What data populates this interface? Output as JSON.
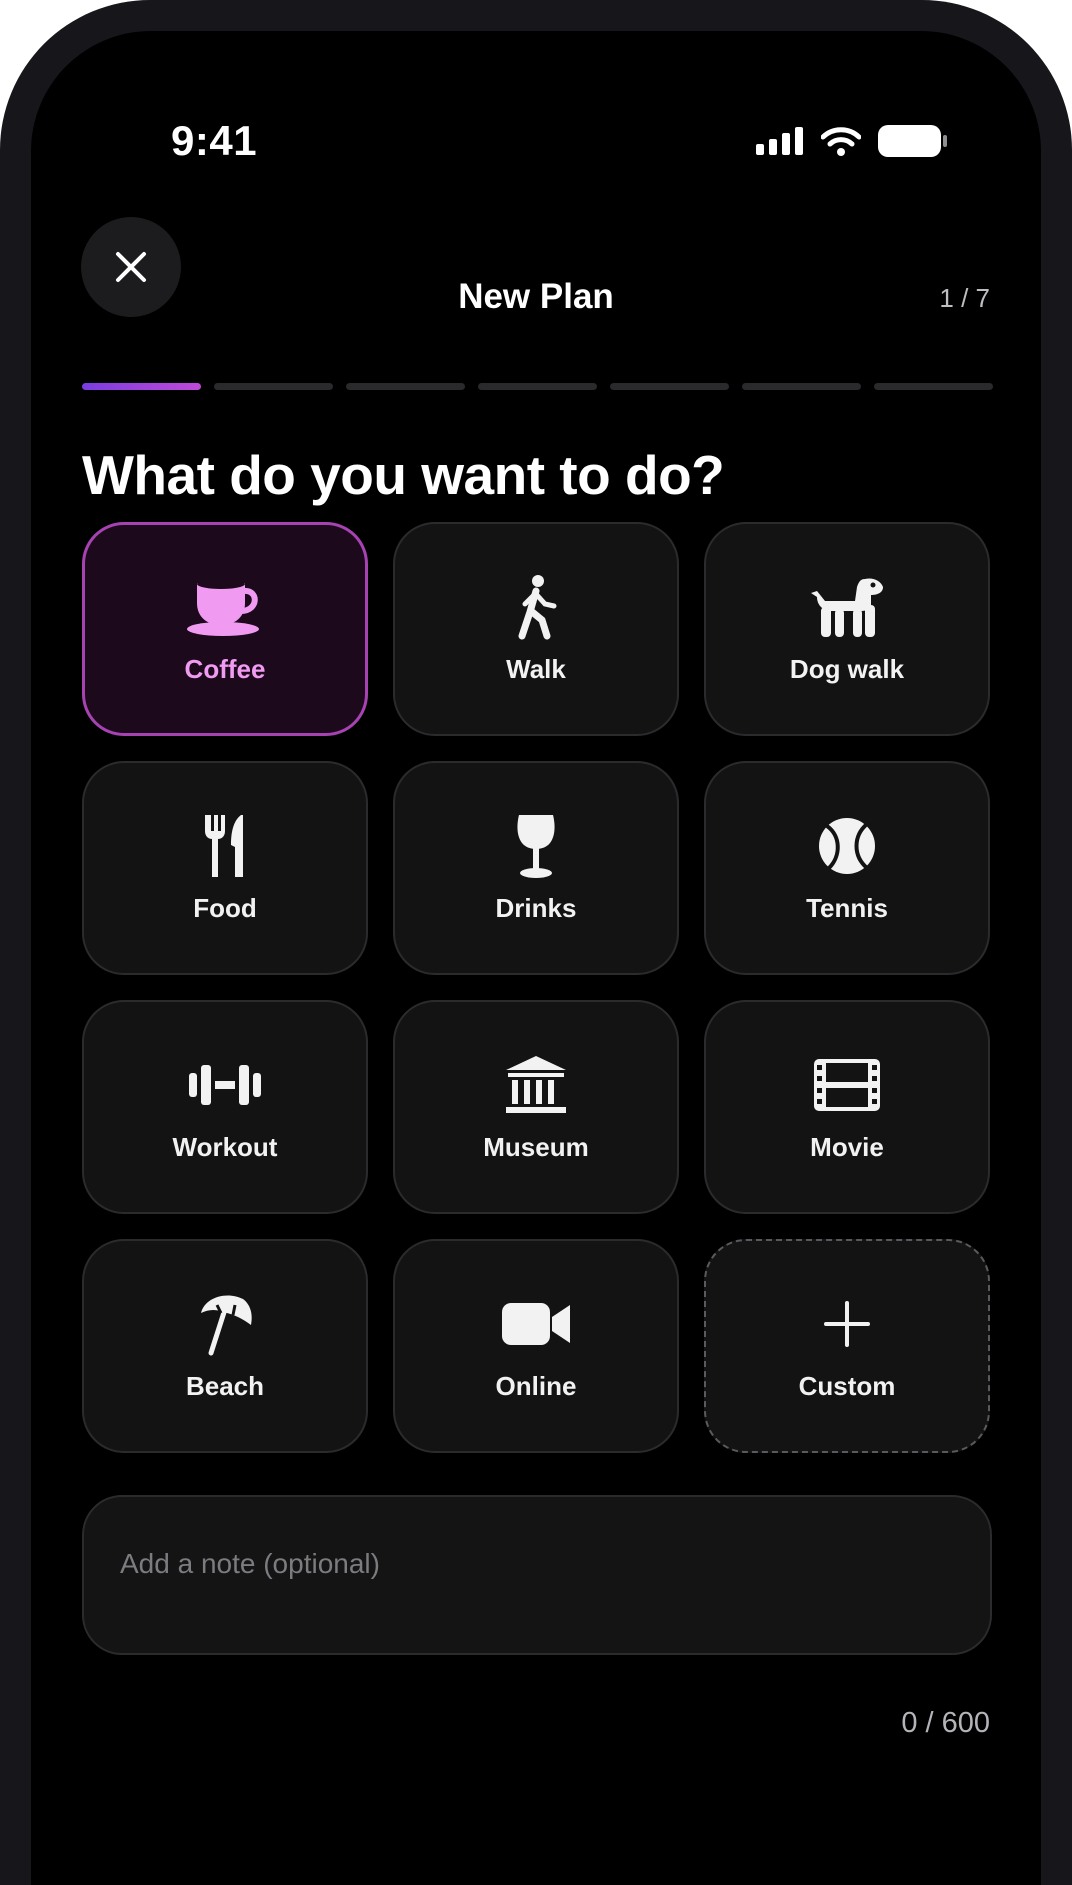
{
  "status_bar": {
    "time": "9:41"
  },
  "header": {
    "title": "New Plan",
    "step": "1 / 7"
  },
  "progress": {
    "current": 1,
    "total": 7
  },
  "question": "What do you want to do?",
  "options": [
    {
      "label": "Coffee",
      "icon": "coffee-cup-icon",
      "selected": true
    },
    {
      "label": "Walk",
      "icon": "walking-person-icon",
      "selected": false
    },
    {
      "label": "Dog walk",
      "icon": "dog-icon",
      "selected": false
    },
    {
      "label": "Food",
      "icon": "fork-knife-icon",
      "selected": false
    },
    {
      "label": "Drinks",
      "icon": "wine-glass-icon",
      "selected": false
    },
    {
      "label": "Tennis",
      "icon": "tennis-ball-icon",
      "selected": false
    },
    {
      "label": "Workout",
      "icon": "dumbbell-icon",
      "selected": false
    },
    {
      "label": "Museum",
      "icon": "museum-icon",
      "selected": false
    },
    {
      "label": "Movie",
      "icon": "film-icon",
      "selected": false
    },
    {
      "label": "Beach",
      "icon": "beach-umbrella-icon",
      "selected": false
    },
    {
      "label": "Online",
      "icon": "video-camera-icon",
      "selected": false
    },
    {
      "label": "Custom",
      "icon": "plus-icon",
      "selected": false
    }
  ],
  "note": {
    "placeholder": "Add a note (optional)",
    "value": ""
  },
  "counter": "0 / 600",
  "colors": {
    "accent": "#a742b3",
    "accent_text": "#f09af2",
    "progress_gradient": [
      "#7a3de0",
      "#c04ad8"
    ]
  }
}
